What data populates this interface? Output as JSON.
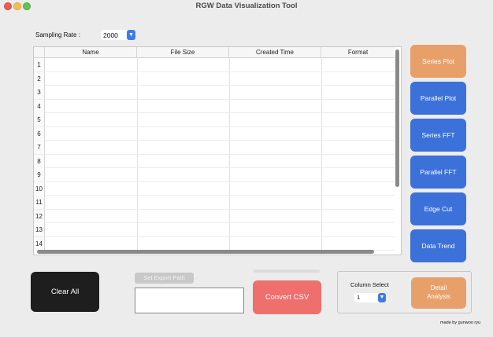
{
  "window": {
    "title": "RGW Data Visualization Tool"
  },
  "sampling": {
    "label": "Sampling Rate :",
    "value": "2000"
  },
  "table": {
    "columns": [
      "Name",
      "File Size",
      "Created Time",
      "Format"
    ],
    "rows": [
      "1",
      "2",
      "3",
      "4",
      "5",
      "6",
      "7",
      "8",
      "9",
      "10",
      "11",
      "12",
      "13",
      "14"
    ]
  },
  "side_buttons": {
    "series_plot": "Series Plot",
    "parallel_plot": "Parallel Plot",
    "series_fft": "Series FFT",
    "parallel_fft": "Parallel FFT",
    "edge_cut": "Edge Cut",
    "data_trend": "Data Trend"
  },
  "bottom": {
    "clear_all": "Clear All",
    "set_export_path": "Set Export Path",
    "export_path_value": "",
    "convert_csv": "Convert CSV",
    "column_select_label": "Column Select",
    "column_select_value": "1",
    "detail_analysis_line1": "Detail",
    "detail_analysis_line2": "Analysis"
  },
  "credit": "made by gunwoo ryu",
  "colors": {
    "primary_blue": "#3b71d8",
    "accent_orange": "#e8a06a",
    "convert_red": "#ef6f6c",
    "dark_button": "#1e1e1e"
  }
}
